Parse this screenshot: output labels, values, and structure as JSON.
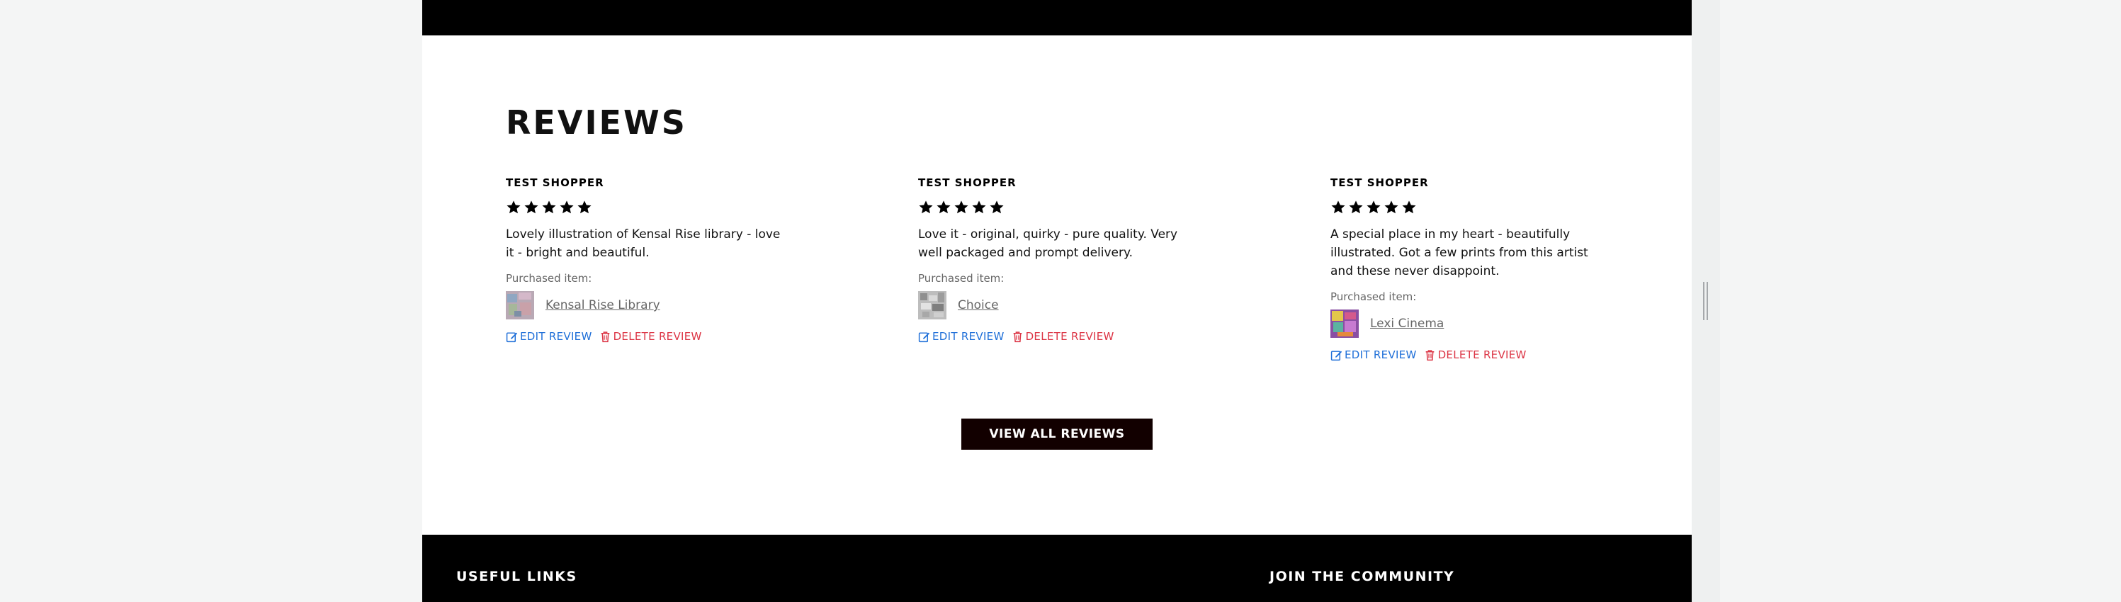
{
  "reviews_section": {
    "title": "Reviews",
    "view_all_label": "VIEW ALL REVIEWS",
    "items": [
      {
        "reviewer": "TEST SHOPPER",
        "rating": 5,
        "text": "Lovely illustration of Kensal Rise library - love it - bright and beautiful.",
        "purchased_label": "Purchased item:",
        "item_name": "Kensal Rise Library",
        "edit_label": "EDIT REVIEW",
        "delete_label": "DELETE REVIEW"
      },
      {
        "reviewer": "TEST SHOPPER",
        "rating": 5,
        "text": "Love it - original, quirky - pure quality. Very well packaged and prompt delivery.",
        "purchased_label": "Purchased item:",
        "item_name": "Choice",
        "edit_label": "EDIT REVIEW",
        "delete_label": "DELETE REVIEW"
      },
      {
        "reviewer": "TEST SHOPPER",
        "rating": 5,
        "text": "A special place in my heart - beautifully illustrated. Got a few prints from this artist and these never disappoint.",
        "purchased_label": "Purchased item:",
        "item_name": "Lexi Cinema",
        "edit_label": "EDIT REVIEW",
        "delete_label": "DELETE REVIEW"
      }
    ]
  },
  "footer": {
    "useful_links_heading": "USEFUL LINKS",
    "join_heading": "JOIN THE COMMUNITY"
  },
  "colors": {
    "edit": "#1f6fd8",
    "delete": "#dc3545",
    "button_bg": "#120000",
    "band": "#000000"
  },
  "icons": [
    "star-icon",
    "edit-icon",
    "trash-icon"
  ]
}
